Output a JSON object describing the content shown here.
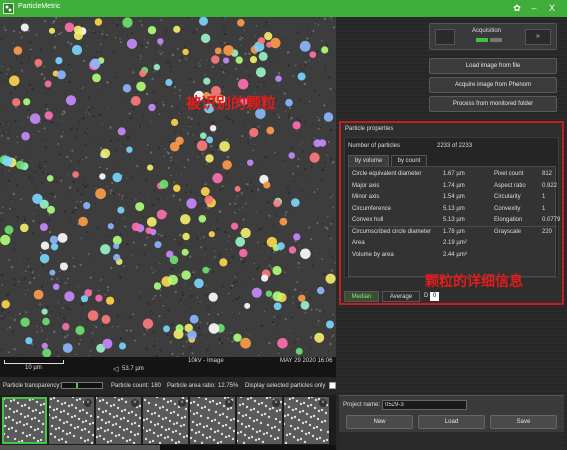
{
  "app": {
    "title": "ParticleMetric"
  },
  "window_controls": {
    "minimize": "–",
    "close": "X"
  },
  "image": {
    "annotation_label": "被识别的颗粒",
    "scale_bar": "10 µm",
    "hfw": "53.7 µm",
    "voltage_mode": "10kV - Image",
    "datetime": "MAY 29 2020 16:06"
  },
  "status": {
    "transparency_label": "Particle transparency:",
    "transparency_value": 0.35,
    "count_label": "Particle count:",
    "count_value": "180",
    "area_ratio_label": "Particle area ratio:",
    "area_ratio_value": "12.75%",
    "display_selected_label": "Display selected particles only"
  },
  "thumbnails": {
    "count": 7,
    "selected_index": 0
  },
  "acquisition": {
    "label": "Acquisition",
    "next_label": "»"
  },
  "actions": {
    "load_file": "Load image from file",
    "acquire_phenom": "Acquire image from Phenom",
    "process_folder": "Process from monitored folder"
  },
  "properties": {
    "title": "Particle properties",
    "number_label": "Number of particles",
    "number_value": "2233 of 2233",
    "tab_volume": "by volume",
    "tab_count": "by count",
    "rows_left": [
      {
        "label": "Circle equivalent diameter",
        "value": "1.67 µm"
      },
      {
        "label": "Major axis",
        "value": "1.74 µm"
      },
      {
        "label": "Minor axis",
        "value": "1.54 µm"
      },
      {
        "label": "Circumference",
        "value": "5.13 µm"
      },
      {
        "label": "Convex hull",
        "value": "5.13 µm"
      },
      {
        "label": "Circumscribed circle diameter",
        "value": "1.78 µm"
      },
      {
        "label": "Area",
        "value": "2.19 µm²"
      },
      {
        "label": "Volume by area",
        "value": "2.44 µm³"
      }
    ],
    "rows_right": [
      {
        "label": "Pixel count",
        "value": "812"
      },
      {
        "label": "Aspect ratio",
        "value": "0.922"
      },
      {
        "label": "Circularity",
        "value": "1"
      },
      {
        "label": "Convexity",
        "value": "1"
      },
      {
        "label": "Elongation",
        "value": "0.0779"
      },
      {
        "label": "Grayscale",
        "value": "220"
      }
    ],
    "annotation_label": "颗粒的详细信息",
    "median_tab": "Median",
    "average_tab": "Average",
    "std_prefix": "D",
    "std_value": "0"
  },
  "project": {
    "name_label": "Project name:",
    "name_value": "0529-3",
    "new_button": "New",
    "load_button": "Load",
    "save_button": "Save"
  },
  "colors": {
    "accent": "#3fae3a",
    "annotation": "#e21c1c",
    "particles": [
      "#ff6fb0",
      "#ffd84a",
      "#6ee36e",
      "#7ad7ff",
      "#c88bff",
      "#ff9b4a",
      "#9af5c8",
      "#f5f06a",
      "#8cb8ff",
      "#ff7a7a",
      "#b0ff7a",
      "#ffffff"
    ]
  }
}
